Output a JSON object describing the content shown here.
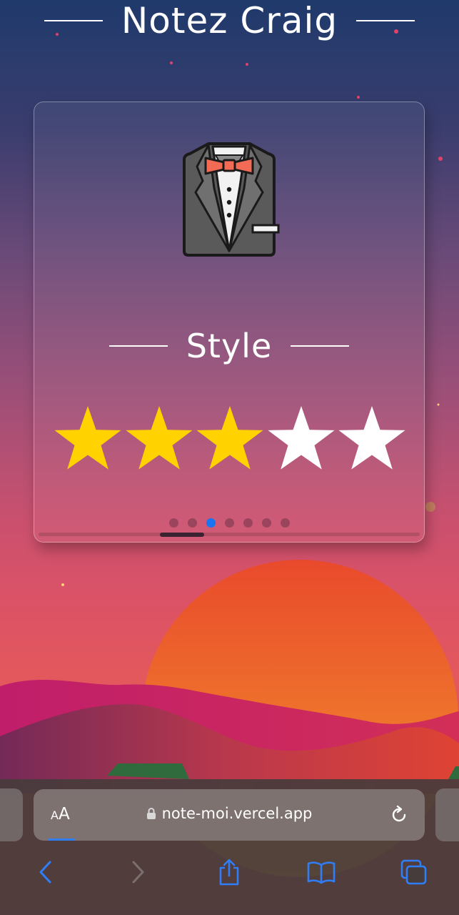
{
  "header": {
    "title": "Notez Craig"
  },
  "card": {
    "icon": "tuxedo-icon",
    "category": "Style",
    "rating": 3,
    "max_rating": 5,
    "pagination": {
      "total": 7,
      "active_index": 2
    },
    "scroll_position": 0.36
  },
  "browser": {
    "text_size_label_small": "A",
    "text_size_label_large": "A",
    "url": "note-moi.vercel.app",
    "load_progress": 0.07
  },
  "colors": {
    "star_filled": "#FFD200",
    "star_empty": "#FFFFFF",
    "active_dot": "#1A73F0",
    "accent_blue": "#2F7EF5"
  },
  "icons": [
    "tuxedo-icon",
    "star-icon",
    "lock-icon",
    "reload-icon",
    "back-arrow-icon",
    "forward-arrow-icon",
    "share-icon",
    "bookmarks-icon",
    "tabs-icon"
  ]
}
